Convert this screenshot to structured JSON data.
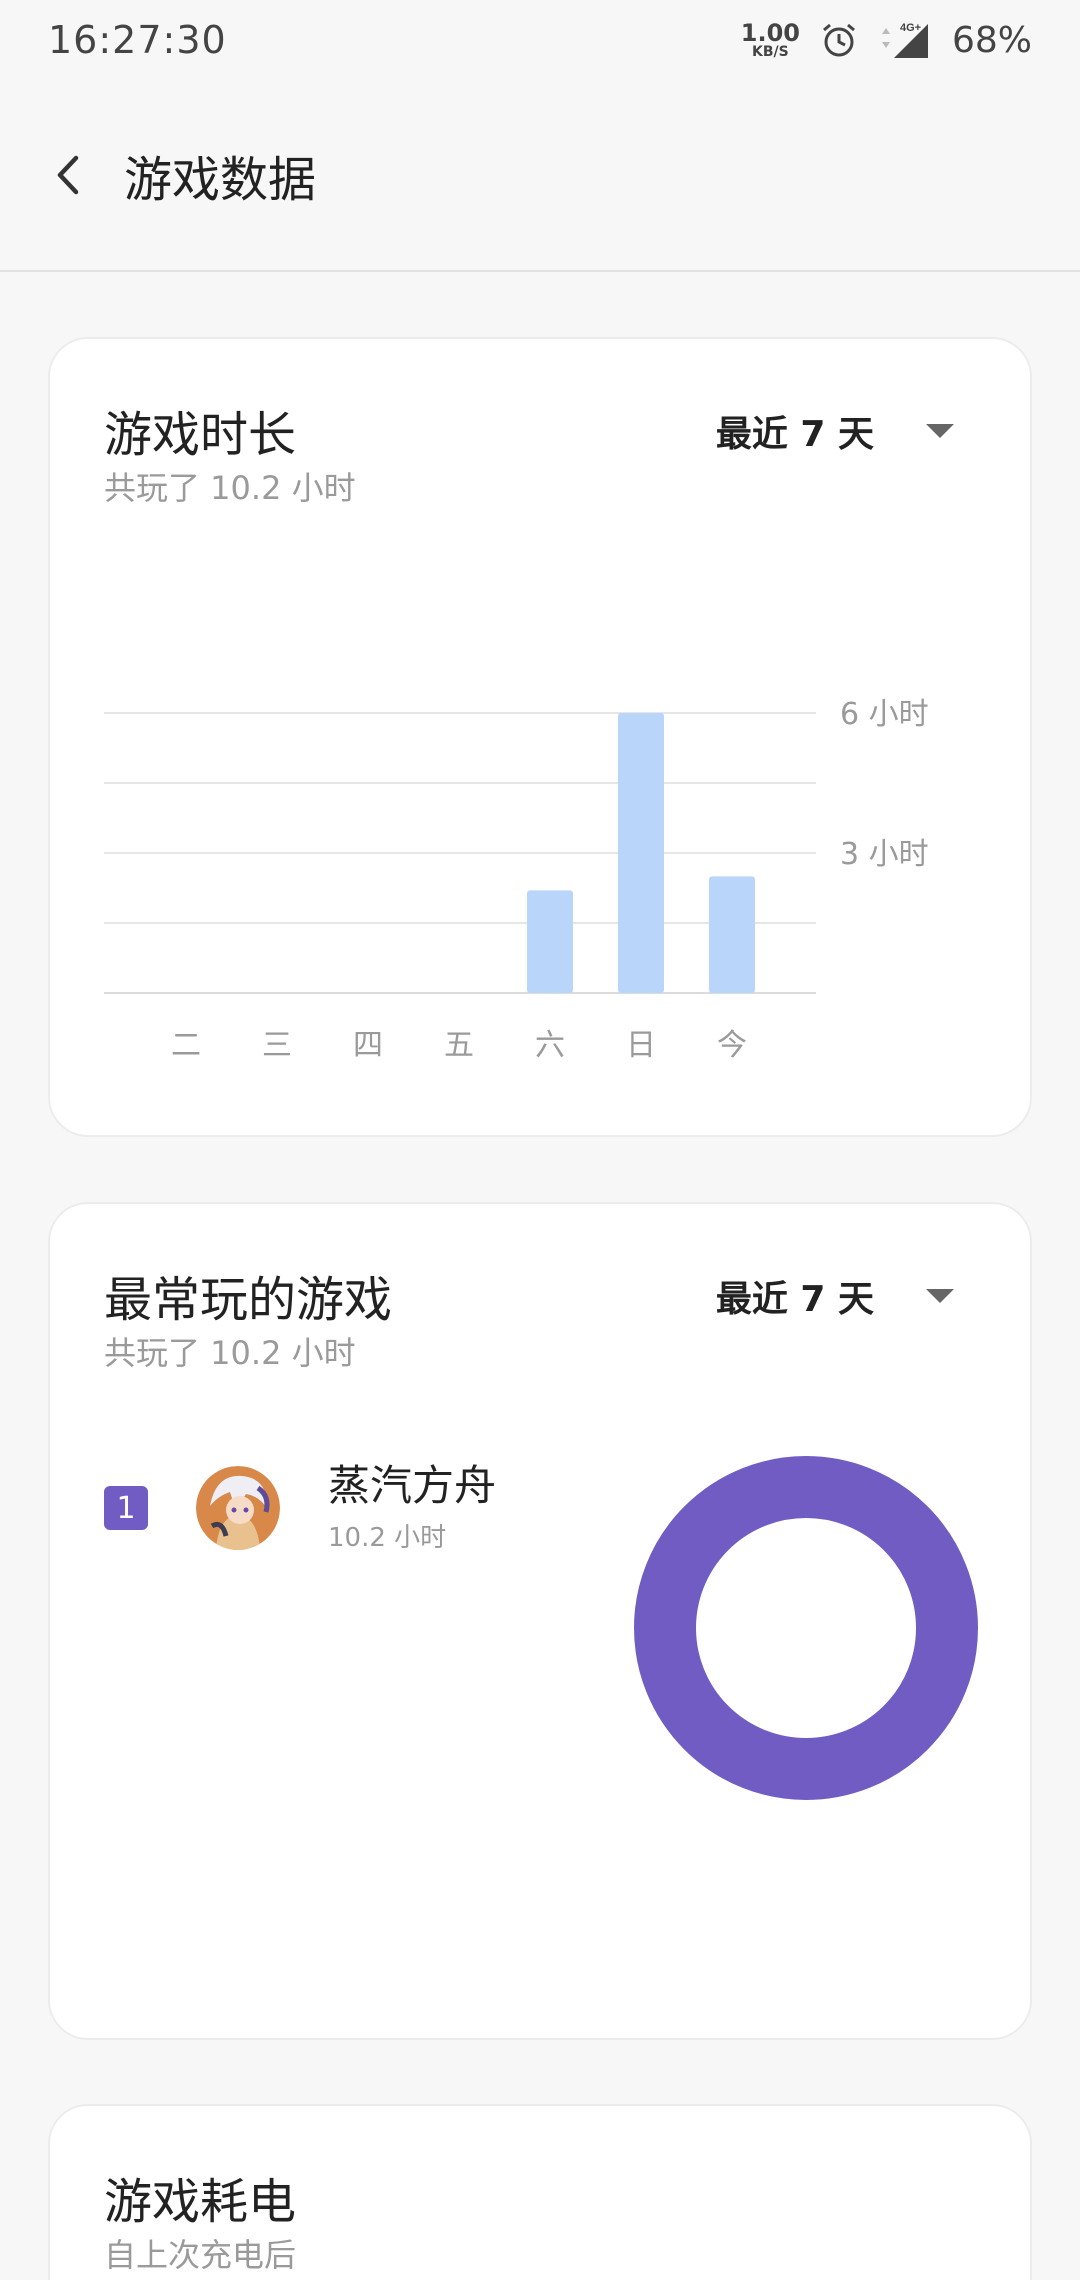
{
  "status_bar": {
    "time": "16:27:30",
    "net_speed_value": "1.00",
    "net_speed_unit": "KB/S",
    "network": "4G+",
    "battery": "68%",
    "icons": [
      "alarm-icon",
      "data-arrows-icon",
      "signal-icon"
    ]
  },
  "app_bar": {
    "title": "游戏数据",
    "back_icon": "chevron-left-icon"
  },
  "usage_card": {
    "title": "游戏时长",
    "subtitle": "共玩了 10.2 小时",
    "range": "最近 7 天"
  },
  "games_card": {
    "title": "最常玩的游戏",
    "subtitle": "共玩了 10.2 小时",
    "range": "最近 7 天",
    "games": [
      {
        "rank": "1",
        "name": "蒸汽方舟",
        "time": "10.2 小时",
        "color": "#705cc2"
      }
    ]
  },
  "power_card": {
    "title": "游戏耗电",
    "subtitle": "自上次充电后"
  },
  "chart_data": [
    {
      "type": "bar",
      "categories": [
        "二",
        "三",
        "四",
        "五",
        "六",
        "日",
        "今"
      ],
      "values": [
        0,
        0,
        0,
        0,
        2.2,
        6.0,
        2.5
      ],
      "ylim": [
        0,
        6
      ],
      "ytick_labels": [
        {
          "value": 6,
          "label": "6 小时"
        },
        {
          "value": 3,
          "label": "3 小时"
        }
      ],
      "grid": true,
      "bar_color": "#b9d6fa",
      "grid_color": "#e6e6e6"
    },
    {
      "type": "pie",
      "style": "donut",
      "labels": [
        "蒸汽方舟"
      ],
      "values": [
        10.2
      ],
      "colors": [
        "#705cc2"
      ]
    }
  ]
}
